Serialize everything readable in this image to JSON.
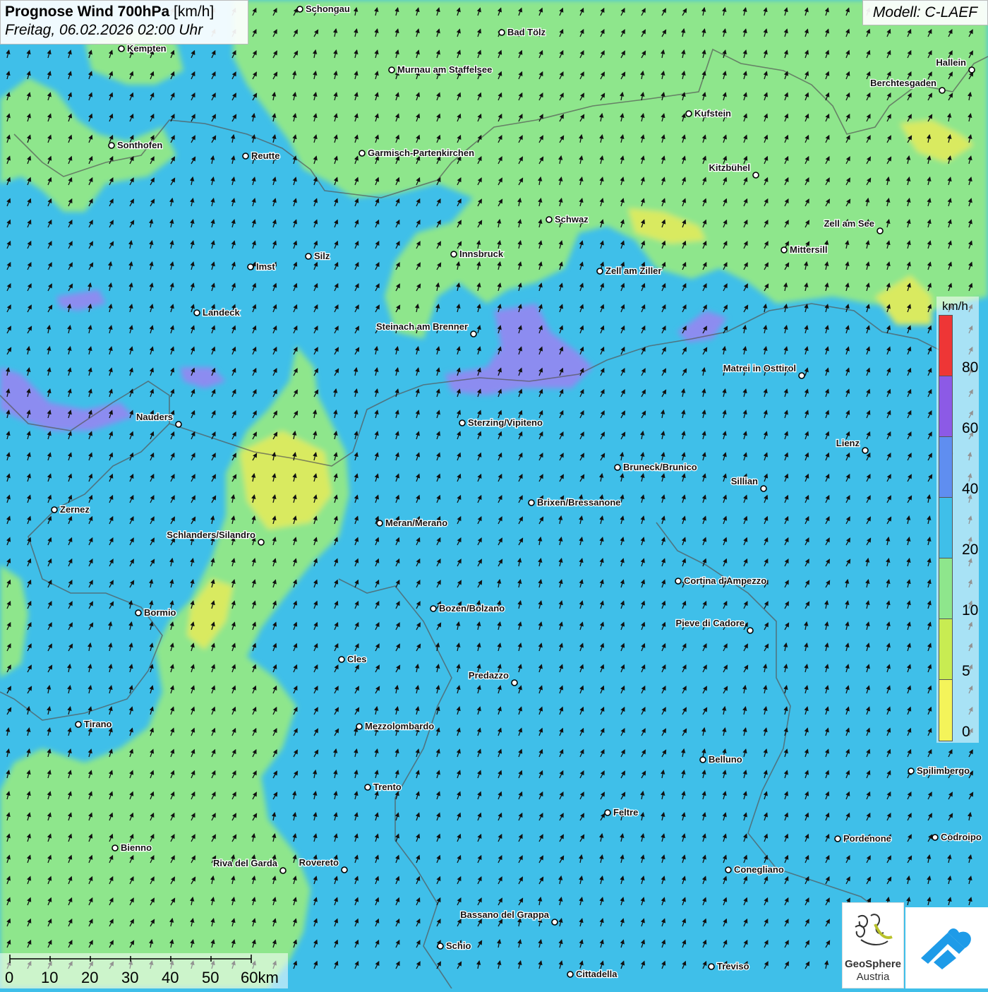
{
  "header": {
    "title": "Prognose Wind 700hPa",
    "unit": "[km/h]",
    "datetime": "Freitag, 06.02.2026 02:00 Uhr",
    "model": "Modell: C-LAEF"
  },
  "legend": {
    "unit": "km/h",
    "ticks": [
      "80",
      "60",
      "40",
      "20",
      "10",
      "5",
      "0"
    ],
    "bins": [
      {
        "color": "#ee3636"
      },
      {
        "color": "#8c5ae6"
      },
      {
        "color": "#5f8ef0"
      },
      {
        "color": "#3fbfe9"
      },
      {
        "color": "#8ee68c"
      },
      {
        "color": "#c8ec52"
      },
      {
        "color": "#f4f45a"
      }
    ]
  },
  "scale": {
    "ticks": [
      "0",
      "10",
      "20",
      "30",
      "40",
      "50",
      "60km"
    ]
  },
  "logos": {
    "geosphere_line1": "GeoSphere",
    "geosphere_line2": "Austria"
  },
  "colors": {
    "calm": "#8ee68c",
    "moderate": "#3fbfe9",
    "strong": "#8c8cf0",
    "very_weak": "#d9ea60"
  },
  "wind": {
    "prevailing_direction": "SW",
    "note_on_map": "arrows point toward NE"
  },
  "cities": [
    {
      "name": "Schongau"
    },
    {
      "name": "Bad Tölz"
    },
    {
      "name": "Kempten"
    },
    {
      "name": "Murnau am Staffelsee"
    },
    {
      "name": "Hallein"
    },
    {
      "name": "Berchtesgaden"
    },
    {
      "name": "Kufstein"
    },
    {
      "name": "Sonthofen"
    },
    {
      "name": "Reutte"
    },
    {
      "name": "Garmisch-Partenkirchen"
    },
    {
      "name": "Kitzbühel"
    },
    {
      "name": "Schwaz"
    },
    {
      "name": "Zell am See"
    },
    {
      "name": "Mittersill"
    },
    {
      "name": "Innsbruck"
    },
    {
      "name": "Silz"
    },
    {
      "name": "Imst"
    },
    {
      "name": "Zell am Ziller"
    },
    {
      "name": "Landeck"
    },
    {
      "name": "Steinach am Brenner"
    },
    {
      "name": "Matrei in Osttirol"
    },
    {
      "name": "Nauders"
    },
    {
      "name": "Sterzing/Vipiteno"
    },
    {
      "name": "Lienz"
    },
    {
      "name": "Bruneck/Brunico"
    },
    {
      "name": "Sillian"
    },
    {
      "name": "Brixen/Bressanone"
    },
    {
      "name": "Zernez"
    },
    {
      "name": "Meran/Merano"
    },
    {
      "name": "Schlanders/Silandro"
    },
    {
      "name": "Cortina d'Ampezzo"
    },
    {
      "name": "Bozen/Bolzano"
    },
    {
      "name": "Bormio"
    },
    {
      "name": "Pieve di Cadore"
    },
    {
      "name": "Cles"
    },
    {
      "name": "Predazzo"
    },
    {
      "name": "Tirano"
    },
    {
      "name": "Mezzolombardo"
    },
    {
      "name": "Belluno"
    },
    {
      "name": "Spilimbergo"
    },
    {
      "name": "Trento"
    },
    {
      "name": "Feltre"
    },
    {
      "name": "Pordenone"
    },
    {
      "name": "Codroipo"
    },
    {
      "name": "Bienno"
    },
    {
      "name": "Riva del Garda"
    },
    {
      "name": "Rovereto"
    },
    {
      "name": "Conegliano"
    },
    {
      "name": "Bassano del Grappa"
    },
    {
      "name": "Schio"
    },
    {
      "name": "Treviso"
    },
    {
      "name": "Cittadella"
    }
  ]
}
